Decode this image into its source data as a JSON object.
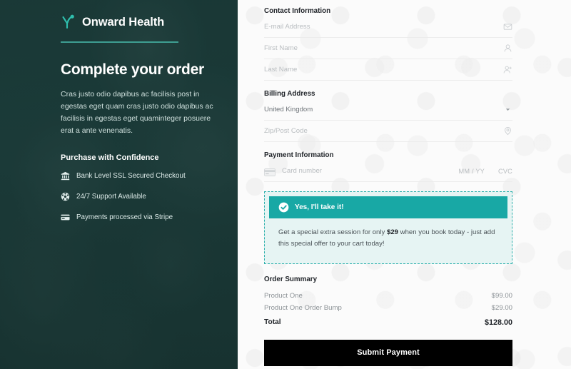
{
  "brand": {
    "name": "Onward Health",
    "logo_icon": "y-sprout-icon",
    "accent_color": "#3e9e92"
  },
  "left_panel": {
    "headline": "Complete your order",
    "blurb": "Cras justo odio dapibus ac facilisis post in egestas eget quam cras justo odio dapibus ac facilisis in egestas eget quaminteger posuere erat a ante venenatis.",
    "confidence_title": "Purchase with Confidence",
    "confidence_items": [
      {
        "icon": "bank-icon",
        "label": "Bank Level SSL Secured Checkout"
      },
      {
        "icon": "support-headset-icon",
        "label": "24/7 Support Available"
      },
      {
        "icon": "credit-card-icon",
        "label": "Payments processed via Stripe"
      }
    ],
    "background_color": "#1e3a38"
  },
  "form": {
    "contact": {
      "title": "Contact Information",
      "fields": [
        {
          "placeholder": "E-mail Address",
          "value": "",
          "icon": "envelope-icon"
        },
        {
          "placeholder": "First Name",
          "value": "",
          "icon": "user-icon"
        },
        {
          "placeholder": "Last Name",
          "value": "",
          "icon": "user-add-icon"
        }
      ]
    },
    "billing": {
      "title": "Billing Address",
      "country_select": {
        "value": "United Kingdom",
        "icon": "chevron-down-icon"
      },
      "zip": {
        "placeholder": "Zip/Post Code",
        "value": "",
        "icon": "location-pin-icon"
      }
    },
    "payment": {
      "title": "Payment Information",
      "card": {
        "icon": "credit-card-icon",
        "placeholder": "Card number",
        "expiry_placeholder": "MM / YY",
        "cvc_placeholder": "CVC"
      }
    }
  },
  "order_bump": {
    "accept_label": "Yes, I'll take it!",
    "check_icon": "check-circle-icon",
    "description_before": "Get a special extra session for only ",
    "price": "$29",
    "description_after": " when you book today - just add this special offer to your cart today!",
    "header_color": "#18a8a5",
    "border_color": "#2bb0ab",
    "body_color": "#e6f4f3"
  },
  "order_summary": {
    "title": "Order Summary",
    "rows": [
      {
        "label": "Product One",
        "value": "$99.00"
      },
      {
        "label": "Product One Order Bump",
        "value": "$29.00"
      }
    ],
    "total": {
      "label": "Total",
      "value": "$128.00"
    }
  },
  "submit": {
    "label": "Submit Payment"
  }
}
